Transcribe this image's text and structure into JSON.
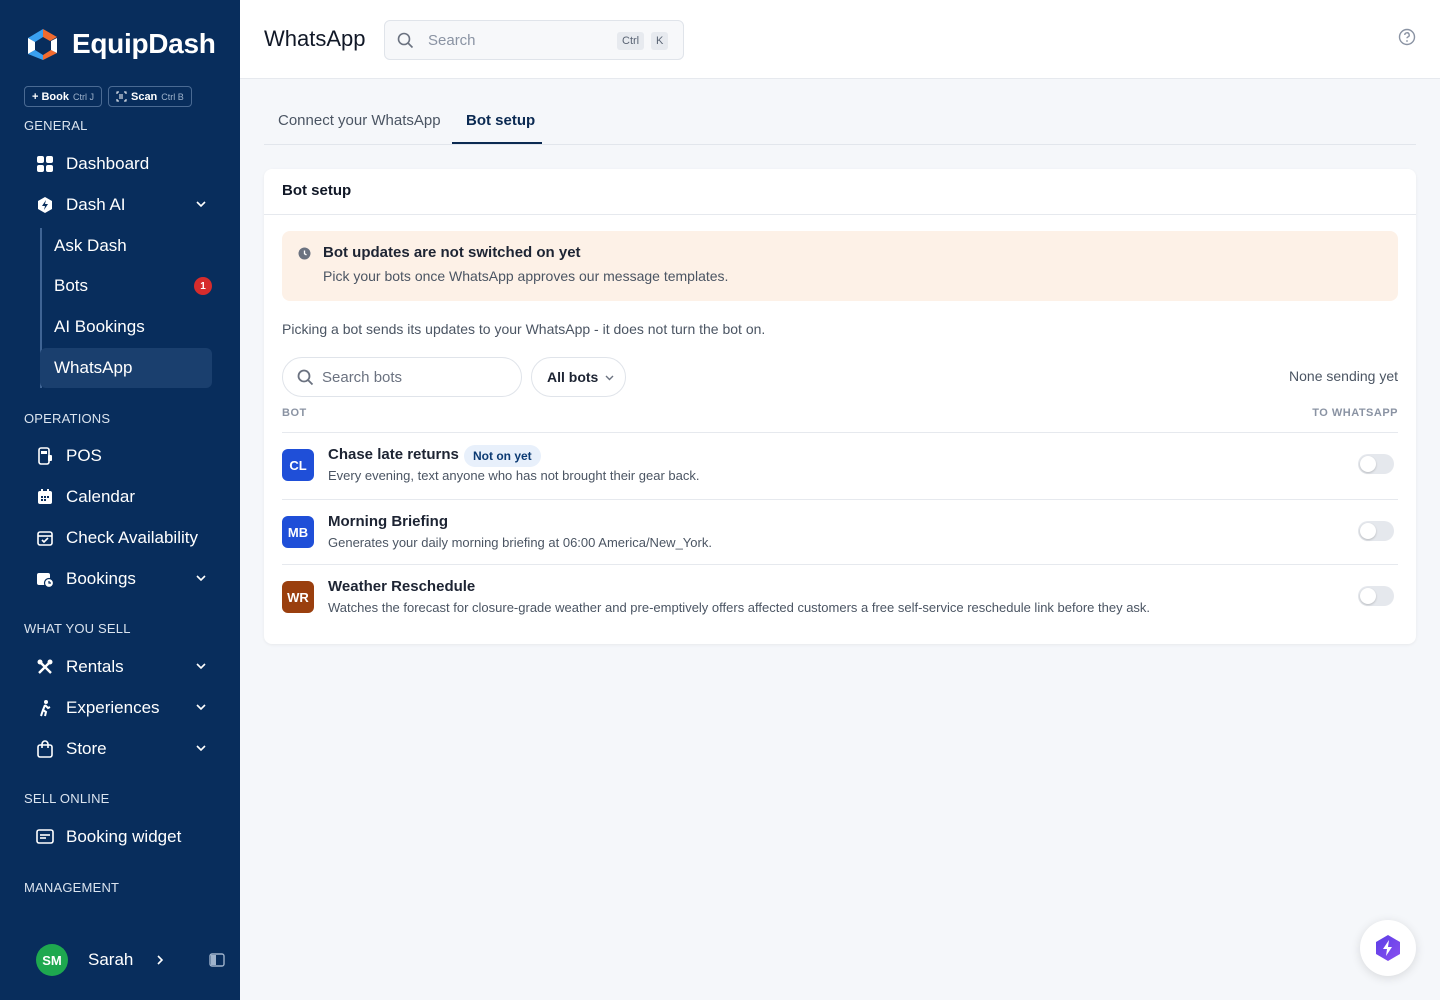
{
  "app": {
    "name": "EquipDash"
  },
  "quick_actions": [
    {
      "label": "+ Book",
      "shortcut": "Ctrl J"
    },
    {
      "label": "Scan",
      "shortcut": "Ctrl B"
    }
  ],
  "sidebar": {
    "general_label": "GENERAL",
    "dashboard": "Dashboard",
    "dash_ai": "Dash AI",
    "sub_items": [
      "Ask Dash",
      "Bots",
      "AI Bookings",
      "WhatsApp"
    ],
    "bots_badge": "1",
    "operations_label": "OPERATIONS",
    "pos": "POS",
    "calendar": "Calendar",
    "check_availability": "Check Availability",
    "bookings": "Bookings",
    "what_you_sell_label": "WHAT YOU SELL",
    "rentals": "Rentals",
    "experiences": "Experiences",
    "store": "Store",
    "sell_online_label": "SELL ONLINE",
    "booking_widget": "Booking widget",
    "management_label": "MANAGEMENT",
    "user": {
      "initials": "SM",
      "name": "Sarah"
    }
  },
  "header": {
    "title": "WhatsApp",
    "search_placeholder": "Search",
    "kbd_ctrl": "Ctrl",
    "kbd_k": "K"
  },
  "tabs": [
    "Connect your WhatsApp",
    "Bot setup"
  ],
  "card": {
    "title": "Bot setup",
    "alert_title": "Bot updates are not switched on yet",
    "alert_body": "Pick your bots once WhatsApp approves our message templates.",
    "hint": "Picking a bot sends its updates to your WhatsApp - it does not turn the bot on.",
    "search_placeholder": "Search bots",
    "filter_label": "All bots",
    "status": "None sending yet",
    "col_bot": "BOT",
    "col_whatsapp": "TO WHATSAPP",
    "bots": [
      {
        "initials": "CL",
        "color": "#1f4fd8",
        "name": "Chase late returns",
        "pill": "Not on yet",
        "desc": "Every evening, text anyone who has not brought their gear back."
      },
      {
        "initials": "MB",
        "color": "#1f4fd8",
        "name": "Morning Briefing",
        "desc": "Generates your daily morning briefing at 06:00 America/New_York."
      },
      {
        "initials": "WR",
        "color": "#9a3f0e",
        "name": "Weather Reschedule",
        "desc": "Watches the forecast for closure-grade weather and pre-emptively offers affected customers a free self-service reschedule link before they ask."
      }
    ]
  },
  "colors": {
    "sidebar": "#082d5c",
    "accent": "#0b2a52",
    "alert_bg": "#fdf1e7"
  }
}
